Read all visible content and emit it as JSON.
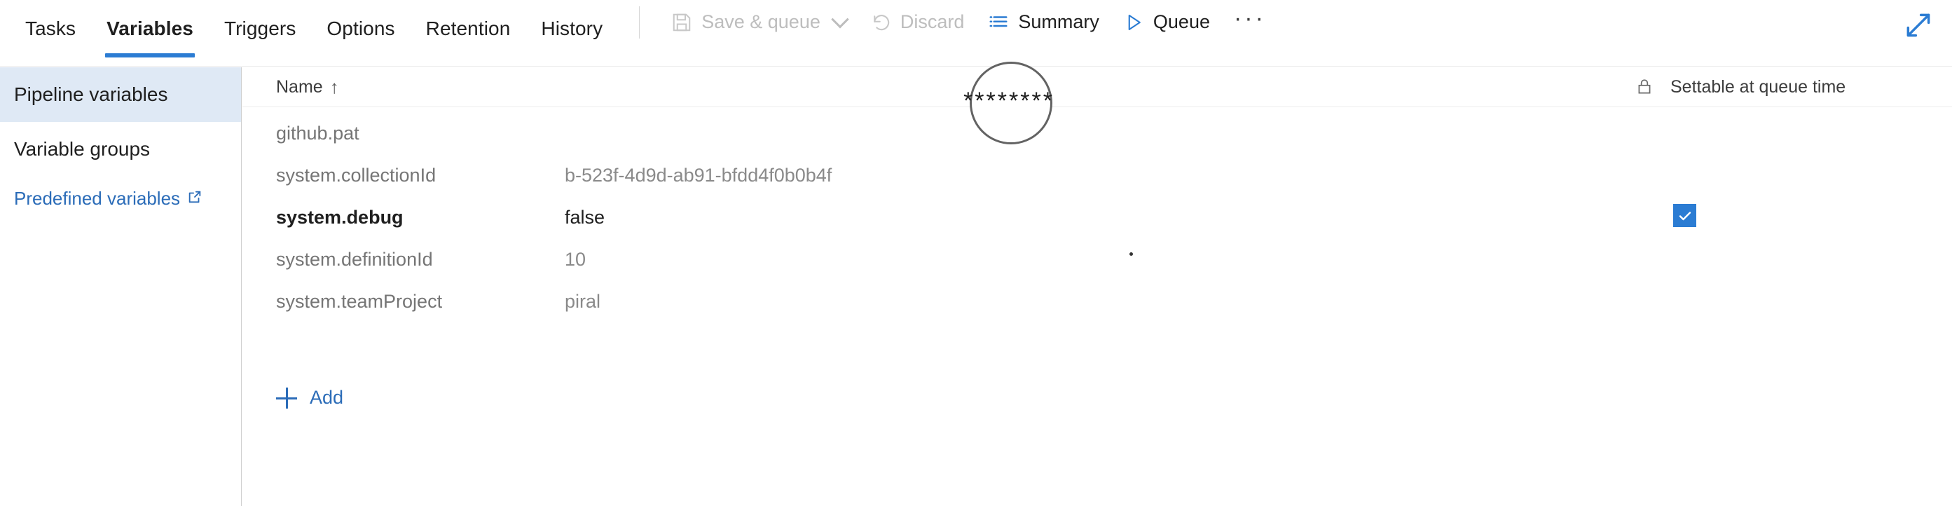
{
  "tabs": [
    {
      "label": "Tasks",
      "active": false
    },
    {
      "label": "Variables",
      "active": true
    },
    {
      "label": "Triggers",
      "active": false
    },
    {
      "label": "Options",
      "active": false
    },
    {
      "label": "Retention",
      "active": false
    },
    {
      "label": "History",
      "active": false
    }
  ],
  "toolbar": {
    "save_queue_label": "Save & queue",
    "discard_label": "Discard",
    "summary_label": "Summary",
    "queue_label": "Queue",
    "overflow_label": "···",
    "expand_icon": "expand-diagonal-icon",
    "save_icon": "floppy-disk-icon",
    "discard_icon": "undo-arrow-icon",
    "summary_icon": "list-lines-icon",
    "queue_icon": "play-triangle-icon"
  },
  "sidebar": {
    "items": [
      {
        "label": "Pipeline variables",
        "selected": true
      },
      {
        "label": "Variable groups",
        "selected": false
      }
    ],
    "link": {
      "label": "Predefined variables",
      "icon": "external-link-icon"
    }
  },
  "grid": {
    "columns": {
      "name": "Name",
      "sort_indicator": "↑",
      "lock_icon": "padlock-icon",
      "settable": "Settable at queue time"
    },
    "rows": [
      {
        "name": "github.pat",
        "value": "",
        "masked": true,
        "settable": false,
        "focused": false
      },
      {
        "name": "system.collectionId",
        "value": "b-523f-4d9d-ab91-bfdd4f0b0b4f",
        "masked": false,
        "settable": false,
        "focused": false
      },
      {
        "name": "system.debug",
        "value": "false",
        "masked": false,
        "settable": true,
        "focused": true
      },
      {
        "name": "system.definitionId",
        "value": "10",
        "masked": false,
        "settable": false,
        "focused": false
      },
      {
        "name": "system.teamProject",
        "value": "piral",
        "masked": false,
        "settable": false,
        "focused": false
      }
    ],
    "add_label": "Add"
  },
  "annotation": {
    "masked_value": "********",
    "shape": "circle-highlight"
  },
  "colors": {
    "accent_blue": "#2b7cd3",
    "link_blue": "#2b6cb8",
    "selected_bg": "#dfe9f5",
    "muted_text": "#8a8a8a",
    "disabled_text": "#bdbdbd"
  }
}
